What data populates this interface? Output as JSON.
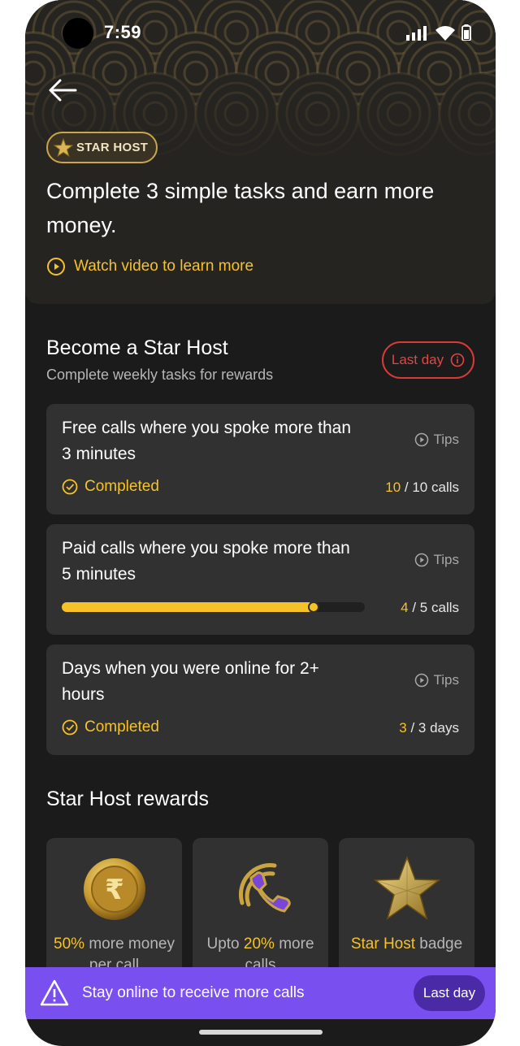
{
  "status_bar": {
    "time": "7:59"
  },
  "hero": {
    "badge_label": "STAR HOST",
    "headline": "Complete 3 simple tasks and earn more money.",
    "watch_link": "Watch video to learn more"
  },
  "section": {
    "title": "Become a Star Host",
    "subtitle": "Complete weekly tasks for rewards",
    "last_day_badge": "Last day"
  },
  "tasks": [
    {
      "title": "Free calls where you spoke more than 3 minutes",
      "tips": "Tips",
      "status": "Completed",
      "done": "10",
      "count_suffix": "/ 10 calls",
      "progress": 1.0
    },
    {
      "title": "Paid calls where you spoke more than 5 minutes",
      "tips": "Tips",
      "status": "",
      "done": "4",
      "count_suffix": "/ 5 calls",
      "progress": 0.83
    },
    {
      "title": "Days when you were online for 2+ hours",
      "tips": "Tips",
      "status": "Completed",
      "done": "3",
      "count_suffix": "/ 3 days",
      "progress": 1.0
    }
  ],
  "rewards": {
    "title": "Star Host rewards",
    "items": [
      {
        "highlight": "50%",
        "rest": " more money per call",
        "icon": "rupee-coin-icon"
      },
      {
        "lead": "Upto ",
        "highlight": "20%",
        "rest": " more calls",
        "icon": "phone-receiver-icon"
      },
      {
        "highlight": "Star Host",
        "rest": " badge",
        "icon": "star-icon"
      }
    ]
  },
  "banner": {
    "message": "Stay online to receive more calls",
    "button": "Last day"
  },
  "colors": {
    "accent": "#f5c228",
    "background": "#1b1b1b",
    "card": "#313131",
    "banner": "#7a4ff0",
    "alert": "#e04646"
  }
}
